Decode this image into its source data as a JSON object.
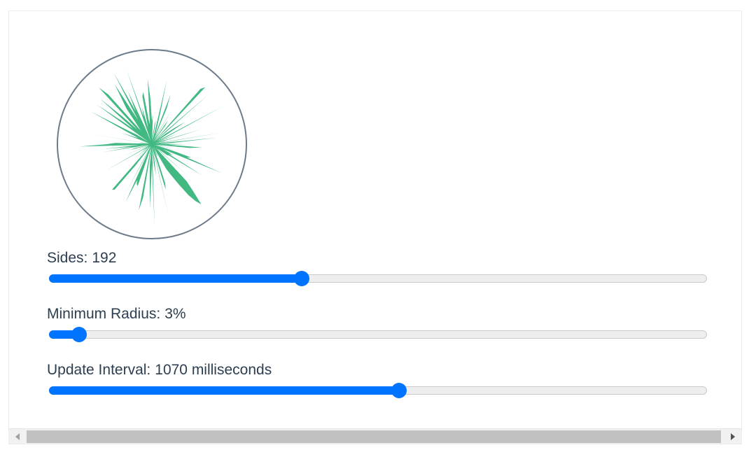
{
  "colors": {
    "accent": "#0073ff",
    "polygon_fill": "#42b883",
    "circle_stroke": "#6c7a89",
    "label_text": "#2c3e50",
    "track_bg": "#eeeeee"
  },
  "polygon": {
    "sides": 192,
    "min_radius_percent": 3
  },
  "controls": [
    {
      "id": "sides",
      "label": "Sides",
      "value_text": "192",
      "fraction": 0.384
    },
    {
      "id": "min-radius",
      "label": "Minimum Radius",
      "value_text": "3%",
      "fraction": 0.045
    },
    {
      "id": "update-interval",
      "label": "Update Interval",
      "value_text": "1070 milliseconds",
      "fraction": 0.532
    }
  ],
  "scrollbar": {
    "left_icon": "triangle-left-icon",
    "right_icon": "triangle-right-icon"
  }
}
